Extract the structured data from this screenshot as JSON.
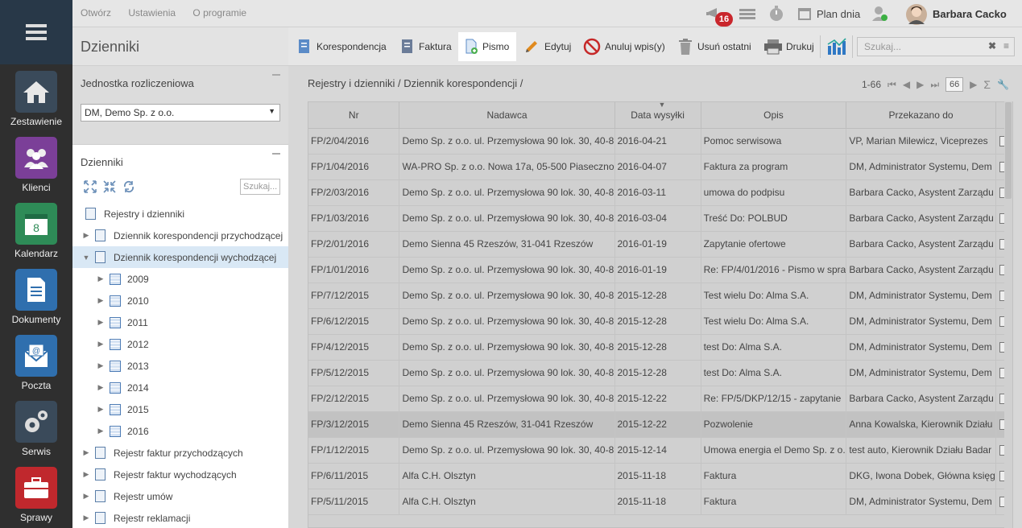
{
  "topbar": {
    "menu": [
      "Otwórz",
      "Ustawienia",
      "O programie"
    ],
    "notification_count": "16",
    "plan_label": "Plan dnia",
    "user_name": "Barbara Cacko"
  },
  "rail": {
    "items": [
      {
        "label": "Zestawienie",
        "icon": "home-icon",
        "color": "#3a4a5a"
      },
      {
        "label": "Klienci",
        "icon": "users-icon",
        "color": "#7b3f98"
      },
      {
        "label": "Kalendarz",
        "icon": "calendar-icon",
        "color": "#2e8b57"
      },
      {
        "label": "Dokumenty",
        "icon": "document-icon",
        "color": "#2f6fae"
      },
      {
        "label": "Poczta",
        "icon": "mail-icon",
        "color": "#2f6fae"
      },
      {
        "label": "Serwis",
        "icon": "gear-icon",
        "color": "#3a4a5a"
      },
      {
        "label": "Sprawy",
        "icon": "briefcase-icon",
        "color": "#c0282d"
      }
    ]
  },
  "left_panel": {
    "title": "Dzienniki",
    "unit_label": "Jednostka rozliczeniowa",
    "unit_value": "DM, Demo Sp. z o.o.",
    "journals_title": "Dzienniki",
    "search_placeholder": "Szukaj...",
    "tree": [
      {
        "label": "Rejestry i dzienniki",
        "level": 0,
        "toggle": "",
        "icon": "doc"
      },
      {
        "label": "Dziennik korespondencji przychodzącej",
        "level": 1,
        "toggle": "▶",
        "icon": "doc"
      },
      {
        "label": "Dziennik korespondencji wychodzącej",
        "level": 1,
        "toggle": "▼",
        "icon": "doc",
        "selected": true
      },
      {
        "label": "2009",
        "level": 2,
        "toggle": "▶",
        "icon": "cal"
      },
      {
        "label": "2010",
        "level": 2,
        "toggle": "▶",
        "icon": "cal"
      },
      {
        "label": "2011",
        "level": 2,
        "toggle": "▶",
        "icon": "cal"
      },
      {
        "label": "2012",
        "level": 2,
        "toggle": "▶",
        "icon": "cal"
      },
      {
        "label": "2013",
        "level": 2,
        "toggle": "▶",
        "icon": "cal"
      },
      {
        "label": "2014",
        "level": 2,
        "toggle": "▶",
        "icon": "cal"
      },
      {
        "label": "2015",
        "level": 2,
        "toggle": "▶",
        "icon": "cal"
      },
      {
        "label": "2016",
        "level": 2,
        "toggle": "▶",
        "icon": "cal"
      },
      {
        "label": "Rejestr faktur przychodzących",
        "level": 1,
        "toggle": "▶",
        "icon": "doc"
      },
      {
        "label": "Rejestr faktur wychodzących",
        "level": 1,
        "toggle": "▶",
        "icon": "doc"
      },
      {
        "label": "Rejestr umów",
        "level": 1,
        "toggle": "▶",
        "icon": "doc"
      },
      {
        "label": "Rejestr reklamacji",
        "level": 1,
        "toggle": "▶",
        "icon": "doc"
      }
    ]
  },
  "toolbar": {
    "korespondencja": "Korespondencja",
    "faktura": "Faktura",
    "pismo": "Pismo",
    "edytuj": "Edytuj",
    "anuluj": "Anuluj wpis(y)",
    "usun": "Usuń ostatni",
    "drukuj": "Drukuj",
    "search_placeholder": "Szukaj..."
  },
  "main": {
    "breadcrumb": "Rejestry i dzienniki / Dziennik korespondencji /",
    "pager_range": "1-66",
    "pager_page": "66",
    "columns": [
      "Nr",
      "Nadawca",
      "Data wysyłki",
      "Opis",
      "Przekazano do"
    ],
    "rows": [
      [
        "FP/2/04/2016",
        "Demo Sp. z o.o. ul. Przemysłowa 90 lok. 30, 40-8",
        "2016-04-21",
        "Pomoc serwisowa",
        "VP, Marian Milewicz, Viceprezes"
      ],
      [
        "FP/1/04/2016",
        "WA-PRO Sp. z o.o. Nowa 17a, 05-500 Piaseczno",
        "2016-04-07",
        "Faktura za program",
        "DM, Administrator Systemu, Dem"
      ],
      [
        "FP/2/03/2016",
        "Demo Sp. z o.o. ul. Przemysłowa 90 lok. 30, 40-8",
        "2016-03-11",
        "umowa do podpisu",
        "Barbara Cacko, Asystent Zarządu"
      ],
      [
        "FP/1/03/2016",
        "Demo Sp. z o.o. ul. Przemysłowa 90 lok. 30, 40-8",
        "2016-03-04",
        "Treść Do: POLBUD",
        "Barbara Cacko, Asystent Zarządu"
      ],
      [
        "FP/2/01/2016",
        "Demo Sienna 45 Rzeszów, 31-041 Rzeszów",
        "2016-01-19",
        "Zapytanie ofertowe",
        "Barbara Cacko, Asystent Zarządu"
      ],
      [
        "FP/1/01/2016",
        "Demo Sp. z o.o. ul. Przemysłowa 90 lok. 30, 40-8",
        "2016-01-19",
        "Re: FP/4/01/2016 - Pismo w spra",
        "Barbara Cacko, Asystent Zarządu"
      ],
      [
        "FP/7/12/2015",
        "Demo Sp. z o.o. ul. Przemysłowa 90 lok. 30, 40-8",
        "2015-12-28",
        "Test wielu Do: Alma S.A.",
        "DM, Administrator Systemu, Dem"
      ],
      [
        "FP/6/12/2015",
        "Demo Sp. z o.o. ul. Przemysłowa 90 lok. 30, 40-8",
        "2015-12-28",
        "Test wielu Do: Alma S.A.",
        "DM, Administrator Systemu, Dem"
      ],
      [
        "FP/4/12/2015",
        "Demo Sp. z o.o. ul. Przemysłowa 90 lok. 30, 40-8",
        "2015-12-28",
        "test Do: Alma S.A.",
        "DM, Administrator Systemu, Dem"
      ],
      [
        "FP/5/12/2015",
        "Demo Sp. z o.o. ul. Przemysłowa 90 lok. 30, 40-8",
        "2015-12-28",
        "test Do: Alma S.A.",
        "DM, Administrator Systemu, Dem"
      ],
      [
        "FP/2/12/2015",
        "Demo Sp. z o.o. ul. Przemysłowa 90 lok. 30, 40-8",
        "2015-12-22",
        "Re: FP/5/DKP/12/15 - zapytanie",
        "Barbara Cacko, Asystent Zarządu"
      ],
      [
        "FP/3/12/2015",
        "Demo Sienna 45 Rzeszów, 31-041 Rzeszów",
        "2015-12-22",
        "Pozwolenie",
        "Anna Kowalska, Kierownik Działu"
      ],
      [
        "FP/1/12/2015",
        "Demo Sp. z o.o. ul. Przemysłowa 90 lok. 30, 40-8",
        "2015-12-14",
        "Umowa energia el Demo Sp. z o.",
        "test auto, Kierownik Działu Badar"
      ],
      [
        "FP/6/11/2015",
        "Alfa C.H. Olsztyn",
        "2015-11-18",
        "Faktura",
        "DKG, Iwona Dobek, Główna księg"
      ],
      [
        "FP/5/11/2015",
        "Alfa C.H. Olsztyn",
        "2015-11-18",
        "Faktura",
        "DM, Administrator Systemu, Dem"
      ]
    ],
    "highlighted_row": 11
  }
}
